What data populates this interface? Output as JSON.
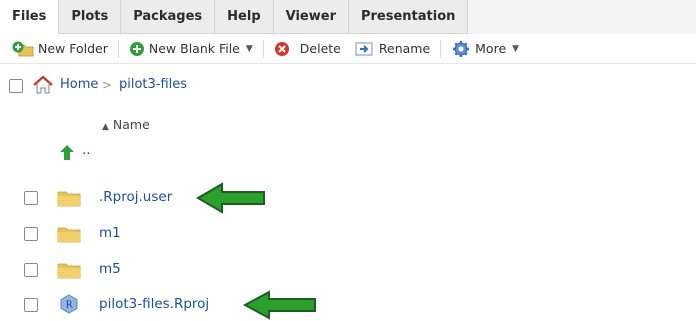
{
  "tabs": [
    {
      "label": "Files",
      "active": true
    },
    {
      "label": "Plots",
      "active": false
    },
    {
      "label": "Packages",
      "active": false
    },
    {
      "label": "Help",
      "active": false
    },
    {
      "label": "Viewer",
      "active": false
    },
    {
      "label": "Presentation",
      "active": false
    }
  ],
  "toolbar": {
    "new_folder": "New Folder",
    "new_blank_file": "New Blank File",
    "delete": "Delete",
    "rename": "Rename",
    "more": "More"
  },
  "breadcrumb": {
    "home": "Home",
    "separator": ">",
    "current": "pilot3-files"
  },
  "columns": {
    "name": "Name"
  },
  "files": {
    "parent": "..",
    "items": [
      {
        "name": ".Rproj.user",
        "type": "folder",
        "highlighted": true
      },
      {
        "name": "m1",
        "type": "folder",
        "highlighted": false
      },
      {
        "name": "m5",
        "type": "folder",
        "highlighted": false
      },
      {
        "name": "pilot3-files.Rproj",
        "type": "rproj",
        "highlighted": true
      }
    ]
  },
  "colors": {
    "link": "#1d4f9c",
    "folder": "#e8c25a",
    "arrow": "#2ca02c",
    "delete": "#d9342b",
    "parent_arrow": "#2e9e3a"
  }
}
